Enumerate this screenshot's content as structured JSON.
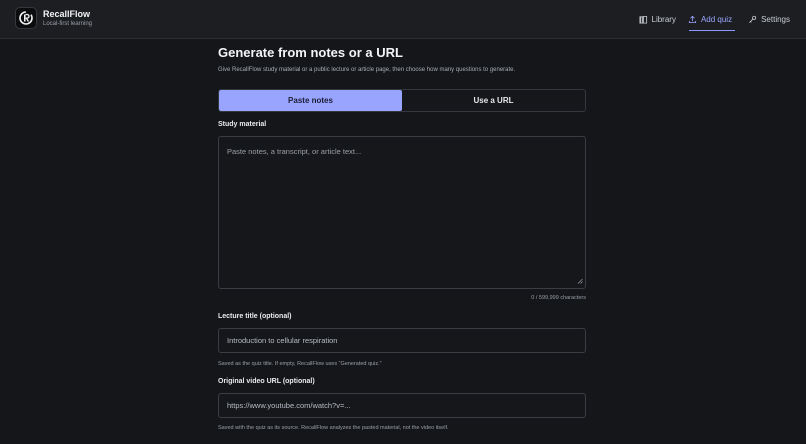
{
  "app": {
    "name": "RecallFlow",
    "tagline": "Local-first learning"
  },
  "nav": {
    "items": [
      {
        "label": "Library",
        "icon": "book-icon"
      },
      {
        "label": "Add quiz",
        "icon": "upload-icon",
        "active": true
      },
      {
        "label": "Settings",
        "icon": "key-icon"
      }
    ]
  },
  "page": {
    "title": "Generate from notes or a URL",
    "subtitle": "Give RecallFlow study material or a public lecture or article page, then choose how many questions to generate."
  },
  "mode": {
    "tabs": [
      {
        "label": "Paste notes",
        "active": true
      },
      {
        "label": "Use a URL",
        "active": false
      }
    ]
  },
  "study_material": {
    "label": "Study material",
    "placeholder": "Paste notes, a transcript, or article text...",
    "counter": "0 / 599,999 characters"
  },
  "lecture_title": {
    "label": "Lecture title (optional)",
    "placeholder": "Introduction to cellular respiration",
    "hint": "Saved as the quiz title. If empty, RecallFlow uses “Generated quiz.”"
  },
  "video_url": {
    "label": "Original video URL (optional)",
    "placeholder": "https://www.youtube.com/watch?v=...",
    "hint": "Saved with the quiz as its source. RecallFlow analyzes the pasted material, not the video itself."
  },
  "colors": {
    "accent": "#99a4ff",
    "background": "#141619",
    "header": "#1c1e22"
  }
}
